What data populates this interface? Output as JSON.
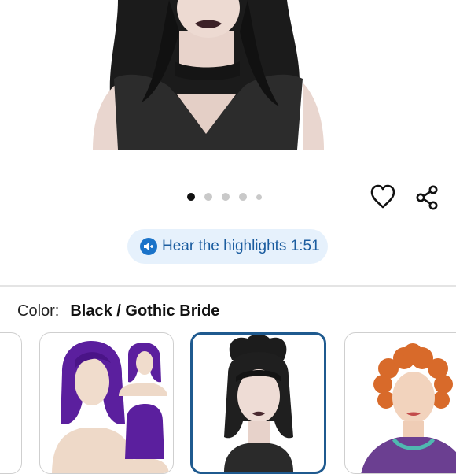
{
  "hero": {
    "carousel": {
      "slides": 5,
      "active_index": 0
    }
  },
  "actions": {
    "favorite_icon": "heart-icon",
    "share_icon": "share-icon"
  },
  "audio": {
    "label": "Hear the highlights 1:51",
    "icon": "speaker-icon"
  },
  "color": {
    "label": "Color:",
    "selected": "Black / Gothic Bride"
  },
  "swatches": [
    {
      "name": "previous-partial",
      "selected": false
    },
    {
      "name": "purple-bob-wig",
      "selected": false
    },
    {
      "name": "black-gothic-bride-wig",
      "selected": true
    },
    {
      "name": "orange-curly-wig",
      "selected": false
    }
  ],
  "colors": {
    "accent": "#1a73c9",
    "pill_bg": "#e6f1fc",
    "selected_border": "#1f5a8f"
  }
}
